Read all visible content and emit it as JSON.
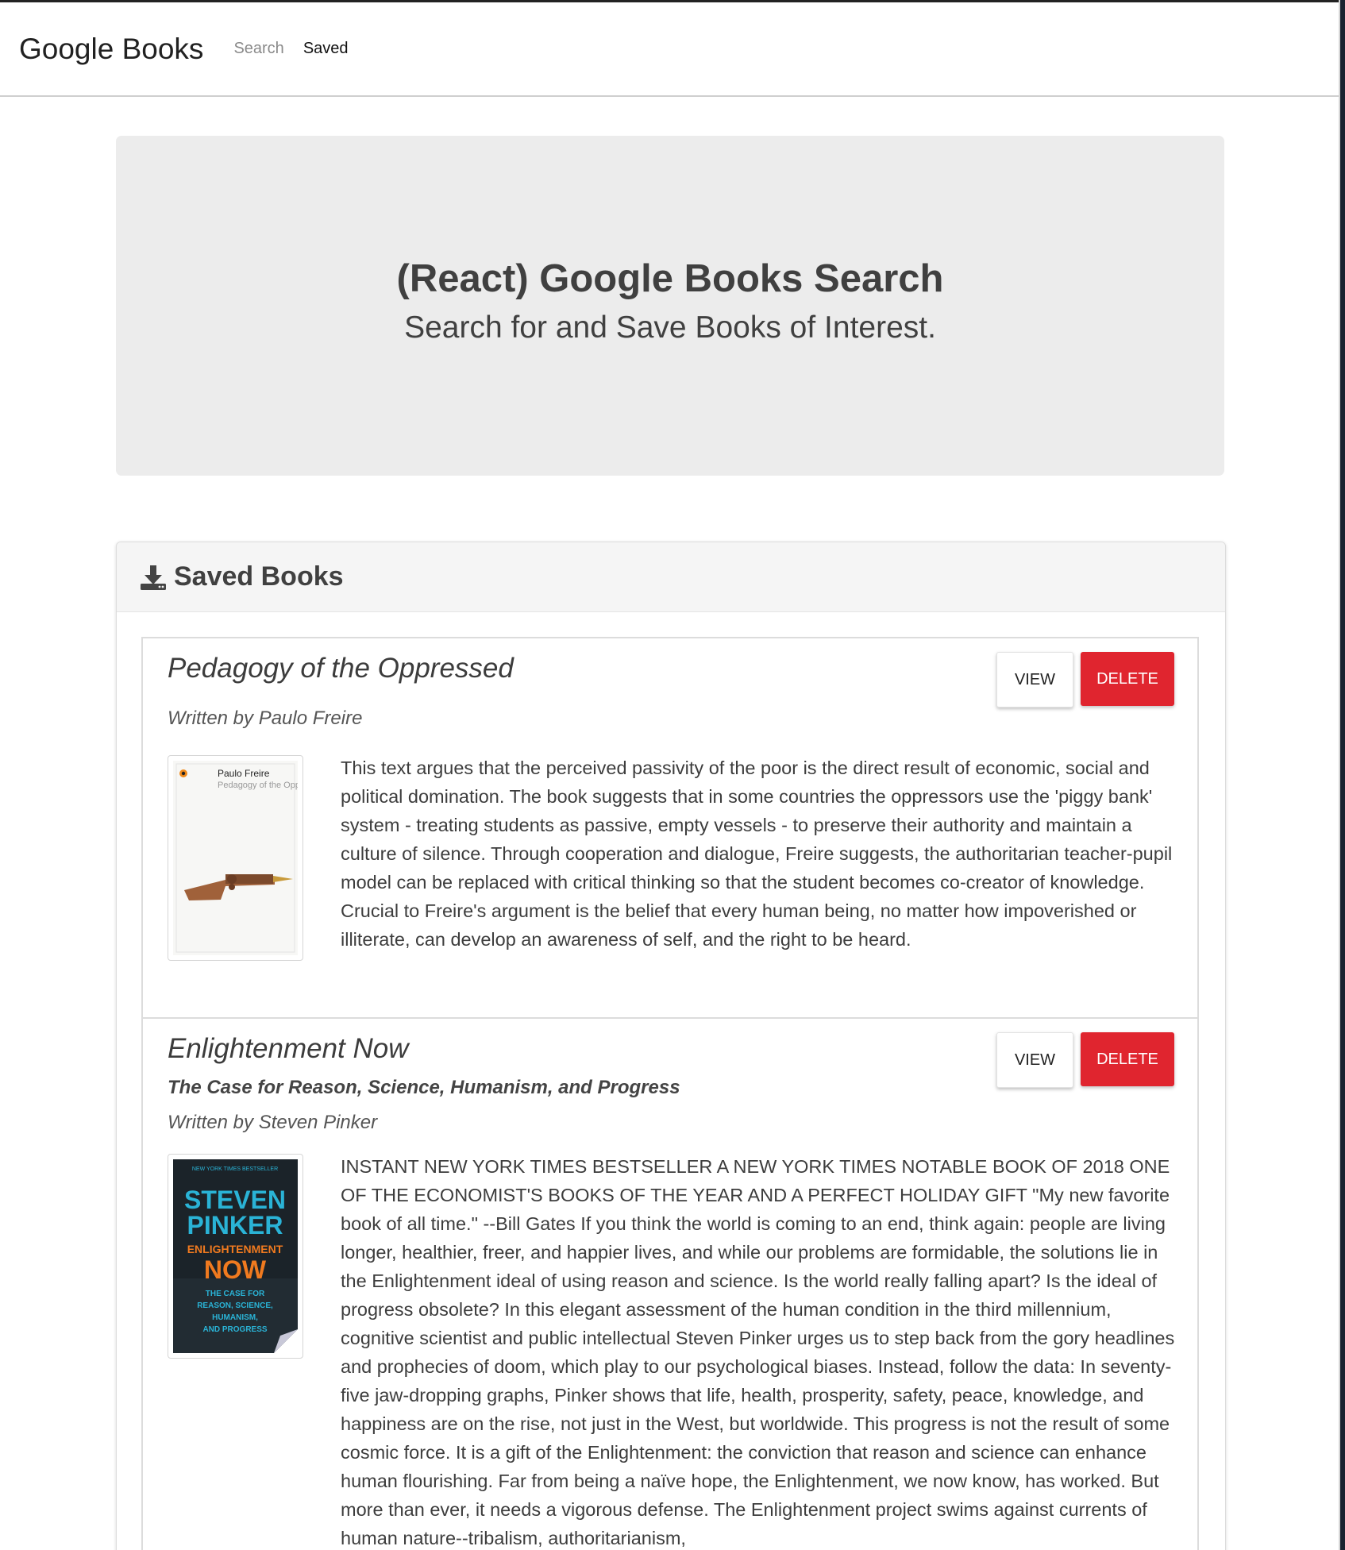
{
  "nav": {
    "brand": "Google Books",
    "links": [
      "Search",
      "Saved"
    ]
  },
  "hero": {
    "title": "(React) Google Books Search",
    "subtitle": "Search for and Save Books of Interest."
  },
  "saved": {
    "header": "Saved Books",
    "header_icon": "download-icon",
    "books": [
      {
        "title": "Pedagogy of the Oppressed",
        "subtitle": "",
        "author": "Written by Paulo Freire",
        "view_label": "VIEW",
        "delete_label": "DELETE",
        "cover": {
          "author": "Paulo Freire",
          "title": "Pedagogy of the Oppressed"
        },
        "description": "This text argues that the perceived passivity of the poor is the direct result of economic, social and political domination. The book suggests that in some countries the oppressors use the 'piggy bank' system - treating students as passive, empty vessels - to preserve their authority and maintain a culture of silence. Through cooperation and dialogue, Freire suggests, the authoritarian teacher-pupil model can be replaced with critical thinking so that the student becomes co-creator of knowledge. Crucial to Freire's argument is the belief that every human being, no matter how impoverished or illiterate, can develop an awareness of self, and the right to be heard."
      },
      {
        "title": "Enlightenment Now",
        "subtitle": "The Case for Reason, Science, Humanism, and Progress",
        "author": "Written by Steven Pinker",
        "view_label": "VIEW",
        "delete_label": "DELETE",
        "cover": {
          "banner": "NEW YORK TIMES BESTSELLER",
          "author_first": "STEVEN",
          "author_last": "PINKER",
          "title_top": "ENLIGHTENMENT",
          "title_main": "NOW",
          "tagline": [
            "THE CASE FOR",
            "REASON, SCIENCE,",
            "HUMANISM,",
            "AND PROGRESS"
          ]
        },
        "description": "INSTANT NEW YORK TIMES BESTSELLER A NEW YORK TIMES NOTABLE BOOK OF 2018 ONE OF THE ECONOMIST'S BOOKS OF THE YEAR AND A PERFECT HOLIDAY GIFT \"My new favorite book of all time.\" --Bill Gates If you think the world is coming to an end, think again: people are living longer, healthier, freer, and happier lives, and while our problems are formidable, the solutions lie in the Enlightenment ideal of using reason and science. Is the world really falling apart? Is the ideal of progress obsolete? In this elegant assessment of the human condition in the third millennium, cognitive scientist and public intellectual Steven Pinker urges us to step back from the gory headlines and prophecies of doom, which play to our psychological biases. Instead, follow the data: In seventy-five jaw-dropping graphs, Pinker shows that life, health, prosperity, safety, peace, knowledge, and happiness are on the rise, not just in the West, but worldwide. This progress is not the result of some cosmic force. It is a gift of the Enlightenment: the conviction that reason and science can enhance human flourishing. Far from being a naïve hope, the Enlightenment, we now know, has worked. But more than ever, it needs a vigorous defense. The Enlightenment project swims against currents of human nature--tribalism, authoritarianism,"
      }
    ]
  },
  "colors": {
    "delete": "#e0252f",
    "hero_bg": "#ececec",
    "cover_dark": "#1b2329",
    "cover_teal": "#2ab3d6",
    "cover_orange": "#f07a1f"
  }
}
